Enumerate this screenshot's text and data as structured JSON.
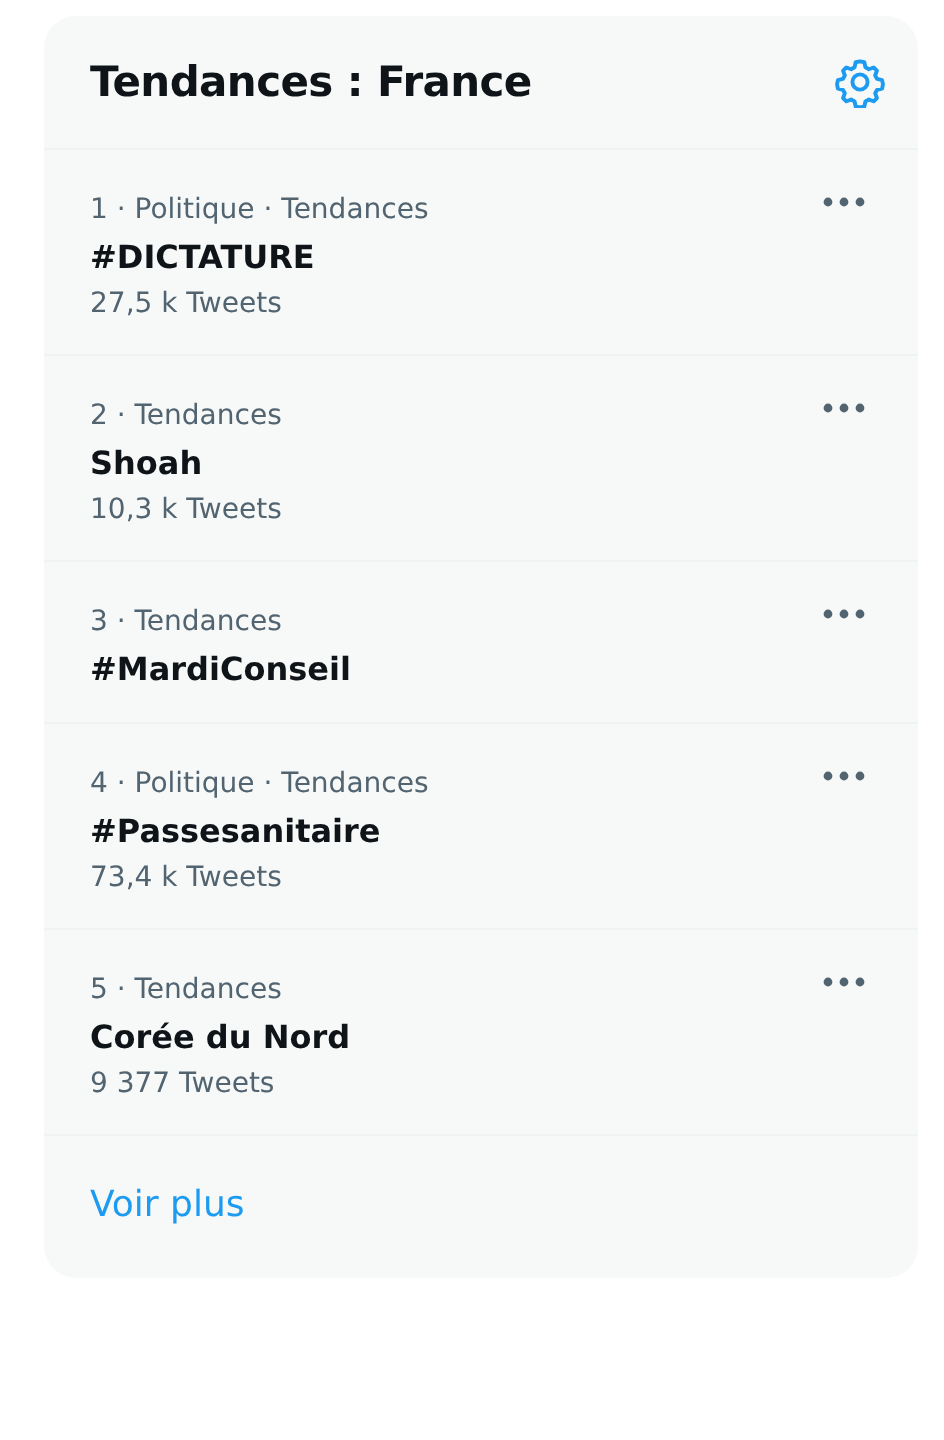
{
  "header": {
    "title": "Tendances : France"
  },
  "trends": [
    {
      "context": "1 · Politique · Tendances",
      "name": "#DICTATURE",
      "count": "27,5 k Tweets"
    },
    {
      "context": "2 · Tendances",
      "name": "Shoah",
      "count": "10,3 k Tweets"
    },
    {
      "context": "3 · Tendances",
      "name": "#MardiConseil"
    },
    {
      "context": "4 · Politique · Tendances",
      "name": "#Passesanitaire",
      "count": "73,4 k Tweets"
    },
    {
      "context": "5 · Tendances",
      "name": "Corée du Nord",
      "count": "9 377 Tweets"
    }
  ],
  "footer": {
    "link": "Voir plus"
  }
}
